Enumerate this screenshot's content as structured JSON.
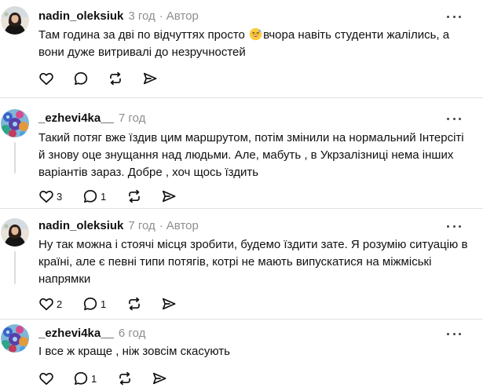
{
  "posts": [
    {
      "username": "nadin_oleksiuk",
      "time": "3 год",
      "author_badge": "Автор",
      "dot": "·",
      "text_before_emoji": "Там година за дві по відчуттях просто ",
      "emoji": "sweat-smile-emoji",
      "text_after_emoji": "вчора навіть студенти жалілись, а вони дуже витривалі до незручностей",
      "likes": "",
      "replies": ""
    },
    {
      "username": "_ezhevi4ka__",
      "time": "7 год",
      "text": "Такий потяг вже їздив цим маршрутом, потім змінили на нормальний Інтерсіті й знову оце знущання над людьми. Але, мабуть , в Укрзалізниці нема інших варіантів зараз. Добре , хоч щось їздить",
      "likes": "3",
      "replies": "1"
    },
    {
      "username": "nadin_oleksiuk",
      "time": "7 год",
      "author_badge": "Автор",
      "dot": "·",
      "text": "Ну так можна і стоячі місця зробити, будемо їздити зате. Я розумію ситуацію в країні, але є певні типи потягів, котрі не мають випускатися на міжміські напрямки",
      "likes": "2",
      "replies": "1"
    },
    {
      "username": "_ezhevi4ka__",
      "time": "6 год",
      "text": "І все ж краще , ніж зовсім скасують",
      "likes": "",
      "replies": "1"
    }
  ],
  "icons": {
    "like": "heart-icon",
    "reply": "comment-icon",
    "repost": "repost-icon",
    "share": "send-icon",
    "more": "more-icon"
  },
  "colors": {
    "text": "#101010",
    "secondary": "#8e8e8e",
    "divider": "#e2e2e2",
    "thread_line": "#dcdcdc"
  }
}
